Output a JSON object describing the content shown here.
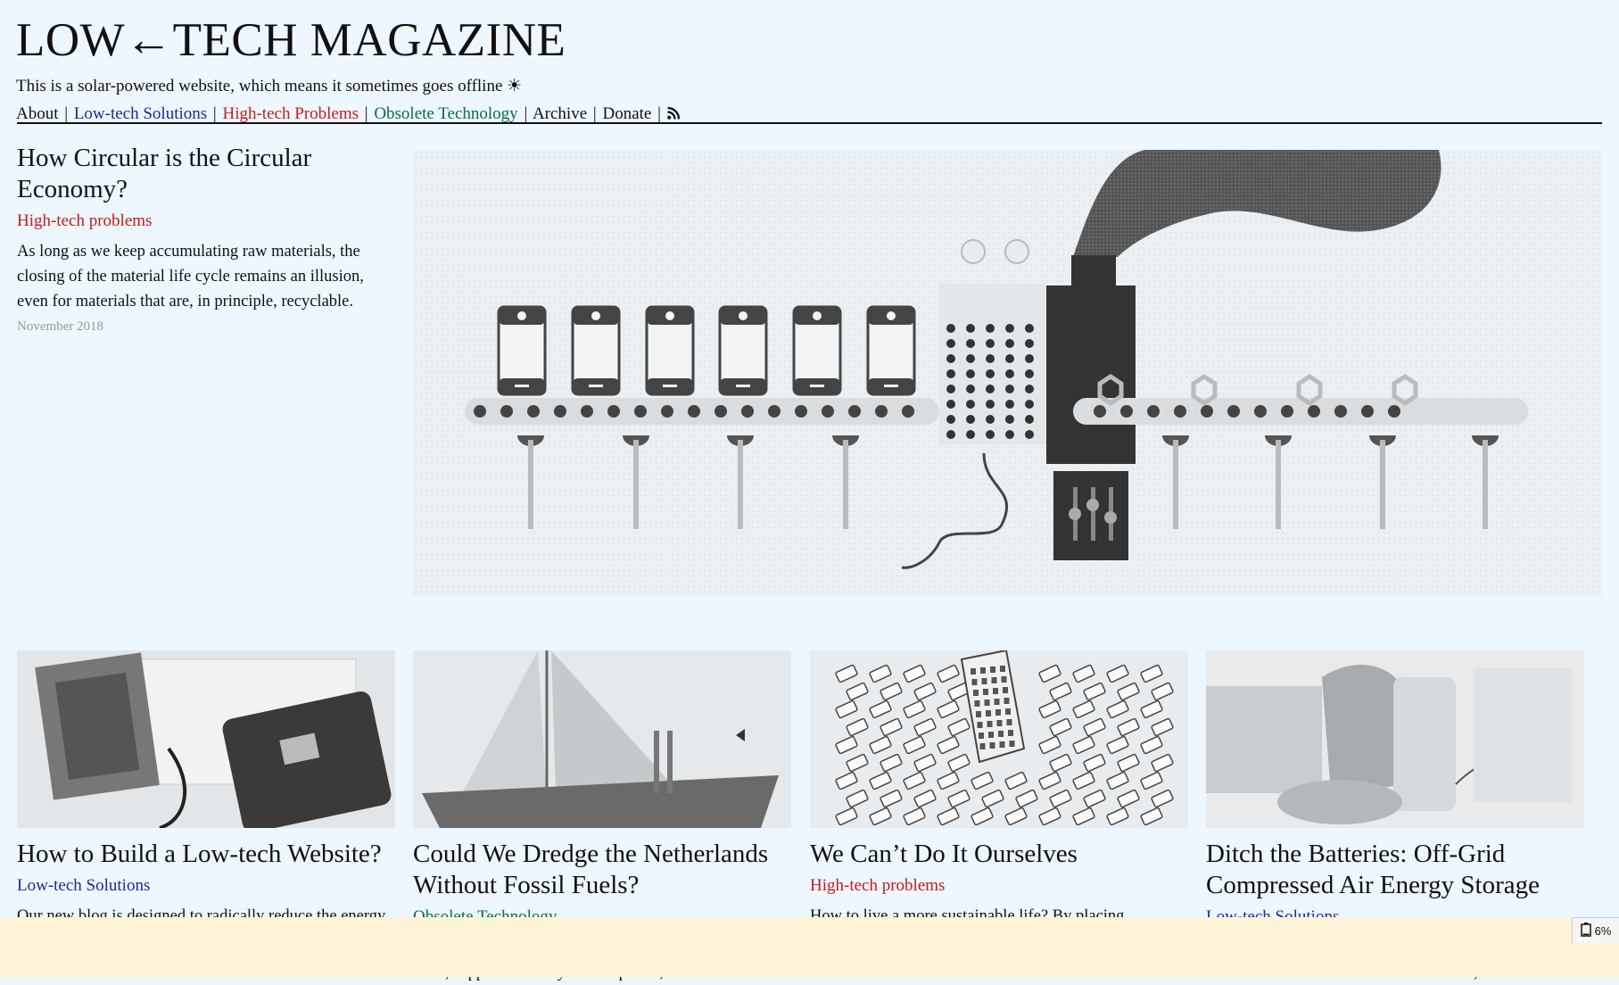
{
  "site": {
    "logo": "LOW←TECH MAGAZINE",
    "tagline": "This is a solar-powered website, which means it sometimes goes offline ☀"
  },
  "nav": {
    "items": [
      {
        "label": "About"
      },
      {
        "label": "Low-tech Solutions"
      },
      {
        "label": "High-tech Problems"
      },
      {
        "label": "Obsolete Technology"
      },
      {
        "label": "Archive"
      },
      {
        "label": "Donate"
      }
    ],
    "separator": "|",
    "rss_icon": "rss-icon"
  },
  "featured": {
    "title": "How Circular is the Circular Economy?",
    "category": "High-tech problems",
    "summary": "As long as we keep accumulating raw materials, the closing of the material life cycle remains an illusion, even for materials that are, in principle, recyclable.",
    "date": "November 2018"
  },
  "articles": [
    {
      "title": "How to Build a Low-tech Website?",
      "category": "Low-tech Solutions",
      "summary": "Our new blog is designed to radically reduce the energy use associated with accessing our content."
    },
    {
      "title": "Could We Dredge the Netherlands Without Fossil Fuels?",
      "category": "Obsolete Technology",
      "summary": "For centuries, the Netherlands were mainly dredged by hand, supplemented by animal power, wind"
    },
    {
      "title": "We Can’t Do It Ourselves",
      "category": "High-tech problems",
      "summary": "How to live a more sustainable life? By placing responsibility squarely on the individual, attention is deflected away from the many institutions involved"
    },
    {
      "title": "Ditch the Batteries: Off-Grid Compressed Air Energy Storage",
      "category": "Low-tech Solutions",
      "summary": "Compressed air energy storage is the sustainable and resilient alternative to chemical batteries, with much"
    }
  ],
  "battery": {
    "level": "6%",
    "icon": "battery-icon"
  },
  "colors": {
    "background": "#eef6fe",
    "low_tech": "#1a2a9a",
    "high_tech": "#c51b1b",
    "obsolete": "#0a6b4c",
    "battery_bar": "#fdf3d6"
  }
}
